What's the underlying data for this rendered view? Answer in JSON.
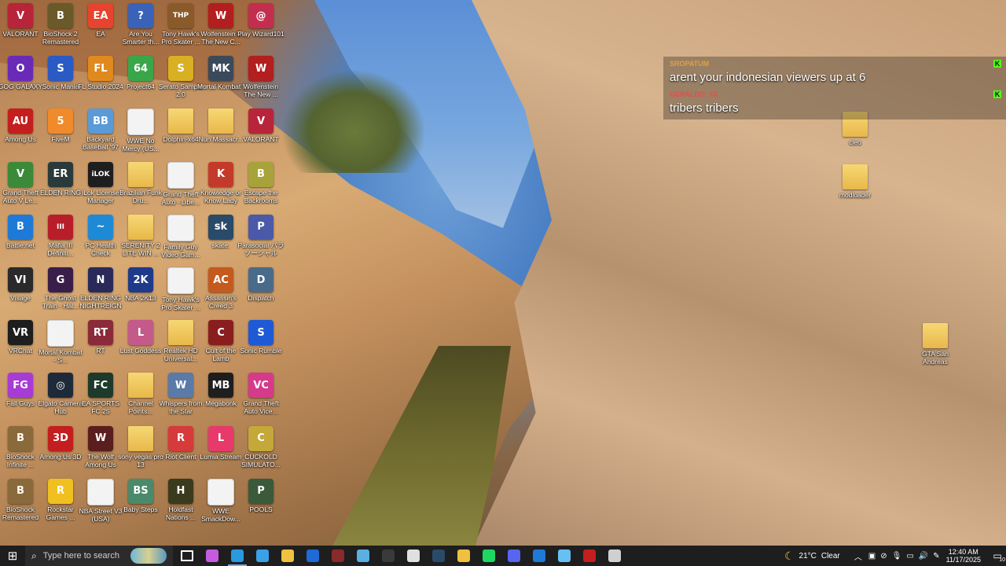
{
  "desktop": {
    "icons": [
      {
        "label": "VALORANT",
        "kind": "app",
        "color": "#b8243a",
        "glyph": "V"
      },
      {
        "label": "BioShock 2 Remastered",
        "kind": "app",
        "color": "#6a5a2a",
        "glyph": "B"
      },
      {
        "label": "EA",
        "kind": "app",
        "color": "#e8432e",
        "glyph": "EA"
      },
      {
        "label": "Are You Smarter th...",
        "kind": "app",
        "color": "#3a62b8",
        "glyph": "?"
      },
      {
        "label": "Tony Hawk's Pro Skater ...",
        "kind": "app",
        "color": "#8b5a2b",
        "glyph": "THP"
      },
      {
        "label": "Wolfenstein II The New C...",
        "kind": "app",
        "color": "#b31e1e",
        "glyph": "W"
      },
      {
        "label": "Play Wizard101",
        "kind": "app",
        "color": "#c42e4e",
        "glyph": "@"
      },
      {
        "label": "GOG GALAXY",
        "kind": "app",
        "color": "#6a2ab8",
        "glyph": "O"
      },
      {
        "label": "Sonic Mania",
        "kind": "app",
        "color": "#2a5ac4",
        "glyph": "S"
      },
      {
        "label": "FL Studio 2024",
        "kind": "app",
        "color": "#e08a1e",
        "glyph": "FL"
      },
      {
        "label": "Project64",
        "kind": "app",
        "color": "#3aa64a",
        "glyph": "64"
      },
      {
        "label": "Serato Sample 2.0",
        "kind": "app",
        "color": "#d8b022",
        "glyph": "S"
      },
      {
        "label": "Mortal Kombat I",
        "kind": "app",
        "color": "#3a4a5a",
        "glyph": "MK"
      },
      {
        "label": "Wolfenstein The New ...",
        "kind": "app",
        "color": "#b31e1e",
        "glyph": "W"
      },
      {
        "label": "Among Us",
        "kind": "app",
        "color": "#c41e1e",
        "glyph": "AU"
      },
      {
        "label": "FiveM",
        "kind": "app",
        "color": "#f08a2a",
        "glyph": "5"
      },
      {
        "label": "Backyard Baseball '97",
        "kind": "app",
        "color": "#5a9ad6",
        "glyph": "BB"
      },
      {
        "label": "WWE No Mercy (US...",
        "kind": "file",
        "color": "#f3f3f3",
        "glyph": ""
      },
      {
        "label": "Dolphin-x64",
        "kind": "folder",
        "color": "#e8b84a",
        "glyph": ""
      },
      {
        "label": "Nun Massacr...",
        "kind": "folder",
        "color": "#e8b84a",
        "glyph": ""
      },
      {
        "label": "VALORANT",
        "kind": "app",
        "color": "#b8243a",
        "glyph": "V"
      },
      {
        "label": "Grand Theft Auto V Le...",
        "kind": "app",
        "color": "#3a8a3a",
        "glyph": "V"
      },
      {
        "label": "ELDEN RING",
        "kind": "app",
        "color": "#2a3a3a",
        "glyph": "ER"
      },
      {
        "label": "iLok License Manager",
        "kind": "app",
        "color": "#1e1e1e",
        "glyph": "iLOK"
      },
      {
        "label": "Brazilian Funk Dru...",
        "kind": "folder",
        "color": "#e8b84a",
        "glyph": ""
      },
      {
        "label": "Grand Theft Auto - Libe...",
        "kind": "file",
        "color": "#f3f3f3",
        "glyph": ""
      },
      {
        "label": "Knowledge or Know Lady",
        "kind": "app",
        "color": "#c43a2a",
        "glyph": "K"
      },
      {
        "label": "Escape the Backrooms",
        "kind": "app",
        "color": "#a8a23a",
        "glyph": "B"
      },
      {
        "label": "Battle.net",
        "kind": "app",
        "color": "#1e7ad6",
        "glyph": "B"
      },
      {
        "label": "Mafia III Definiti...",
        "kind": "app",
        "color": "#b81e2a",
        "glyph": "III"
      },
      {
        "label": "PC Health Check",
        "kind": "app",
        "color": "#1e8ad6",
        "glyph": "~"
      },
      {
        "label": "SERENITY 2 LITE WIN ...",
        "kind": "folder",
        "color": "#e8b84a",
        "glyph": ""
      },
      {
        "label": "Family Guy Video Gam...",
        "kind": "file",
        "color": "#f3f3f3",
        "glyph": ""
      },
      {
        "label": "skate.",
        "kind": "app",
        "color": "#2a4a6a",
        "glyph": "sk"
      },
      {
        "label": "Parasocial パラソーシャル",
        "kind": "app",
        "color": "#4a5aa8",
        "glyph": "P"
      },
      {
        "label": "Visage",
        "kind": "app",
        "color": "#2a2a2a",
        "glyph": "VI"
      },
      {
        "label": "The Ghost Train - Hal...",
        "kind": "app",
        "color": "#3a1e4a",
        "glyph": "G"
      },
      {
        "label": "ELDEN RING NIGHTREIGN",
        "kind": "app",
        "color": "#2a2a5a",
        "glyph": "N"
      },
      {
        "label": "NBA 2K13",
        "kind": "app",
        "color": "#1e3a8a",
        "glyph": "2K"
      },
      {
        "label": "Tony Hawk's Pro Skater ...",
        "kind": "file",
        "color": "#f3f3f3",
        "glyph": ""
      },
      {
        "label": "Assassin's Creed 3",
        "kind": "app",
        "color": "#c45a1e",
        "glyph": "AC"
      },
      {
        "label": "Dispatch",
        "kind": "app",
        "color": "#4a6a8a",
        "glyph": "D"
      },
      {
        "label": "VRChat",
        "kind": "app",
        "color": "#1e1e1e",
        "glyph": "VR"
      },
      {
        "label": "Mortal Kombat - S...",
        "kind": "file",
        "color": "#f3f3f3",
        "glyph": ""
      },
      {
        "label": "RT",
        "kind": "app",
        "color": "#8a2a3a",
        "glyph": "RT"
      },
      {
        "label": "Lust Goddess",
        "kind": "app",
        "color": "#c45a8a",
        "glyph": "L"
      },
      {
        "label": "Realtek HD Universal...",
        "kind": "folder",
        "color": "#e8b84a",
        "glyph": ""
      },
      {
        "label": "Cult of the Lamb",
        "kind": "app",
        "color": "#8a1e1e",
        "glyph": "C"
      },
      {
        "label": "Sonic Rumble",
        "kind": "app",
        "color": "#1e5ad6",
        "glyph": "S"
      },
      {
        "label": "Fall Guys",
        "kind": "app",
        "color": "#a83ad6",
        "glyph": "FG"
      },
      {
        "label": "Elgato Camera Hub",
        "kind": "app",
        "color": "#1e2a3a",
        "glyph": "◎"
      },
      {
        "label": "EA SPORTS FC 25",
        "kind": "app",
        "color": "#1e3a2a",
        "glyph": "FC"
      },
      {
        "label": "Channel Points...",
        "kind": "folder",
        "color": "#e8b84a",
        "glyph": ""
      },
      {
        "label": "Whispers from the Star",
        "kind": "app",
        "color": "#5a7aa8",
        "glyph": "W"
      },
      {
        "label": "Megabonk",
        "kind": "app",
        "color": "#1e1e1e",
        "glyph": "MB"
      },
      {
        "label": "Grand Theft Auto Vice...",
        "kind": "app",
        "color": "#d63a8a",
        "glyph": "VC"
      },
      {
        "label": "BioShock Infinite ...",
        "kind": "app",
        "color": "#8a6a3a",
        "glyph": "B"
      },
      {
        "label": "Among Us 3D",
        "kind": "app",
        "color": "#c41e1e",
        "glyph": "3D"
      },
      {
        "label": "The Wolf Among Us",
        "kind": "app",
        "color": "#5a1e1e",
        "glyph": "W"
      },
      {
        "label": "sony vegas pro 13",
        "kind": "folder",
        "color": "#e8b84a",
        "glyph": ""
      },
      {
        "label": "Riot Client",
        "kind": "app",
        "color": "#d63a3a",
        "glyph": "R"
      },
      {
        "label": "Lumia Stream",
        "kind": "app",
        "color": "#e83a6a",
        "glyph": "L"
      },
      {
        "label": "CUCKOLD SIMULATO...",
        "kind": "app",
        "color": "#c4a83a",
        "glyph": "C"
      },
      {
        "label": "BioShock Remastered",
        "kind": "app",
        "color": "#8a6a3a",
        "glyph": "B"
      },
      {
        "label": "Rockstar Games ...",
        "kind": "app",
        "color": "#f0c020",
        "glyph": "R"
      },
      {
        "label": "NBA Street V3 (USA)",
        "kind": "file",
        "color": "#f3f3f3",
        "glyph": ""
      },
      {
        "label": "Baby Steps",
        "kind": "app",
        "color": "#4a8a6a",
        "glyph": "BS"
      },
      {
        "label": "Holdfast Nations ...",
        "kind": "app",
        "color": "#3a3a1e",
        "glyph": "H"
      },
      {
        "label": "WWE SmackDow...",
        "kind": "file",
        "color": "#f3f3f3",
        "glyph": ""
      },
      {
        "label": "POOLS",
        "kind": "app",
        "color": "#3a5a3a",
        "glyph": "P"
      }
    ],
    "right_icons": [
      {
        "label": "cleo",
        "kind": "folder"
      },
      {
        "label": "modloader",
        "kind": "folder"
      },
      {
        "label": "GTA San Andreas",
        "kind": "folder"
      }
    ]
  },
  "chat": {
    "messages": [
      {
        "user": "SROPATUM",
        "user_color": "#e0a040",
        "text": "arent your indonesian viewers up at 6",
        "badge": "K",
        "badge_color": "#53fc18"
      },
      {
        "user": "GERALDO_XX",
        "user_color": "#e05050",
        "text": "tribers tribers",
        "badge": "K",
        "badge_color": "#53fc18"
      }
    ]
  },
  "taskbar": {
    "start_label": "⊞",
    "search_placeholder": "Type here to search",
    "apps": [
      {
        "name": "task-view",
        "color": "#ffffff"
      },
      {
        "name": "copilot",
        "color": "#c85ae0"
      },
      {
        "name": "edge",
        "color": "#2a9ae0"
      },
      {
        "name": "microsoft-store",
        "color": "#3aa0e8"
      },
      {
        "name": "file-explorer",
        "color": "#f0c040"
      },
      {
        "name": "outlook",
        "color": "#1e6ad6"
      },
      {
        "name": "game-app",
        "color": "#8a2a2a"
      },
      {
        "name": "fall-guys",
        "color": "#5ab0e0"
      },
      {
        "name": "megabonk",
        "color": "#3a3a3a"
      },
      {
        "name": "streamer-app",
        "color": "#e0e0e0"
      },
      {
        "name": "skate",
        "color": "#2a4a6a"
      },
      {
        "name": "notes",
        "color": "#f0c040"
      },
      {
        "name": "spotify",
        "color": "#1ed760"
      },
      {
        "name": "discord",
        "color": "#5865f2"
      },
      {
        "name": "battle-net",
        "color": "#1e7ad6"
      },
      {
        "name": "steam",
        "color": "#66c0f4"
      },
      {
        "name": "mafia",
        "color": "#c41e1e"
      },
      {
        "name": "obs",
        "color": "#d0d0d0"
      }
    ],
    "weather": {
      "temp": "21°C",
      "condition": "Clear"
    },
    "clock": {
      "time": "12:40 AM",
      "date": "11/17/2025"
    },
    "notifications": "10"
  }
}
